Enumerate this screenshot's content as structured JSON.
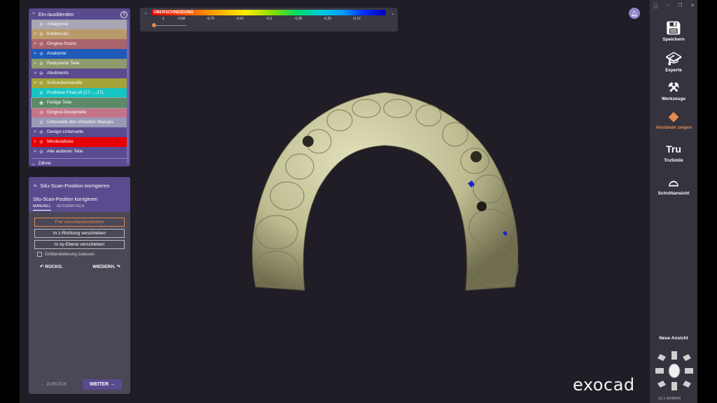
{
  "layers": {
    "title": "Ein-/ausblenden",
    "help_icon": "?",
    "items": [
      {
        "label": "Antagonist",
        "color": "#a9a6b4",
        "arrow": "",
        "eye": "hidden"
      },
      {
        "label": "Kieferscan",
        "color": "#b99a6a",
        "arrow": ">",
        "eye": "hidden"
      },
      {
        "label": "Gingiva-Scans",
        "color": "#a8636c",
        "arrow": ">",
        "eye": "hidden"
      },
      {
        "label": "Anatomie",
        "color": "#1f5ab8",
        "arrow": ">",
        "eye": "hidden"
      },
      {
        "label": "Reduzierte Teile",
        "color": "#8d9a6c",
        "arrow": ">",
        "eye": "hidden"
      },
      {
        "label": "Abutments",
        "color": "#5a4a8e",
        "arrow": ">",
        "eye": "hidden"
      },
      {
        "label": "Schraubenkanäle",
        "color": "#a3a33a",
        "arrow": ">",
        "eye": "hidden"
      },
      {
        "label": "Prothese Final.stl (17-...-27)",
        "color": "#16c4c4",
        "arrow": "",
        "eye": "hidden"
      },
      {
        "label": "Fertige Teile",
        "color": "#5c8a68",
        "arrow": "",
        "eye": "visible"
      },
      {
        "label": "Gingiva-Designteile",
        "color": "#c4748a",
        "arrow": "",
        "eye": "hidden"
      },
      {
        "label": "Unterseite des virtuellen Waxups",
        "color": "#9a9ab8",
        "arrow": "",
        "eye": "hidden"
      },
      {
        "label": "Design-Unterseite",
        "color": "#5a4a8e",
        "arrow": ">",
        "eye": "hidden"
      },
      {
        "label": "Mindestdicke",
        "color": "#e60000",
        "arrow": ">",
        "eye": "hidden"
      },
      {
        "label": "Alle anderen Teile",
        "color": "#5a4a8e",
        "arrow": ">",
        "eye": "hidden"
      }
    ],
    "teeth_label": "Zähne"
  },
  "tool": {
    "title": "Situ-Scan-Position korrigieren",
    "subtitle": "Situ-Scan-Position korrigieren",
    "tabs": [
      "MANUELL",
      "AUTOMATISCH"
    ],
    "active_tab": "MANUELL",
    "buttons": [
      "Frei verschieben/drehen",
      "In z-Richtung verschieben",
      "In xy-Ebene verschieben"
    ],
    "active_button": "Frei verschieben/drehen",
    "checkbox_label": "Größenänderung zulassen",
    "undo_label": "RÜCKG.",
    "redo_label": "WIEDERH.",
    "back_label": "ZURÜCK",
    "next_label": "WEITER"
  },
  "scale": {
    "label": "ÜBERSCHNEIDUNG",
    "min_label": "-1",
    "ticks": [
      "-0,88",
      "-0,75",
      "-0,62",
      "-0,5",
      "-0,38",
      "-0,25",
      "-0,12"
    ],
    "slider_value": "-1"
  },
  "sidebar": {
    "items": [
      {
        "label": "Speichern",
        "icon": "floppy-disk-icon"
      },
      {
        "label": "Experte",
        "icon": "graduation-cap-icon"
      },
      {
        "label": "Werkzeuge",
        "icon": "tools-icon"
      },
      {
        "label": "Abstände zeigen",
        "icon": "distance-icon",
        "active": true
      },
      {
        "label": "TruSmile",
        "icon": "trusmile-icon"
      },
      {
        "label": "Schnittansicht",
        "icon": "section-view-icon"
      }
    ],
    "tru_text": "Tru",
    "new_view_label": "Neue Ansicht",
    "version": "v3.1-8349/64",
    "accent": "#e58a4e"
  },
  "logo": "exocad"
}
